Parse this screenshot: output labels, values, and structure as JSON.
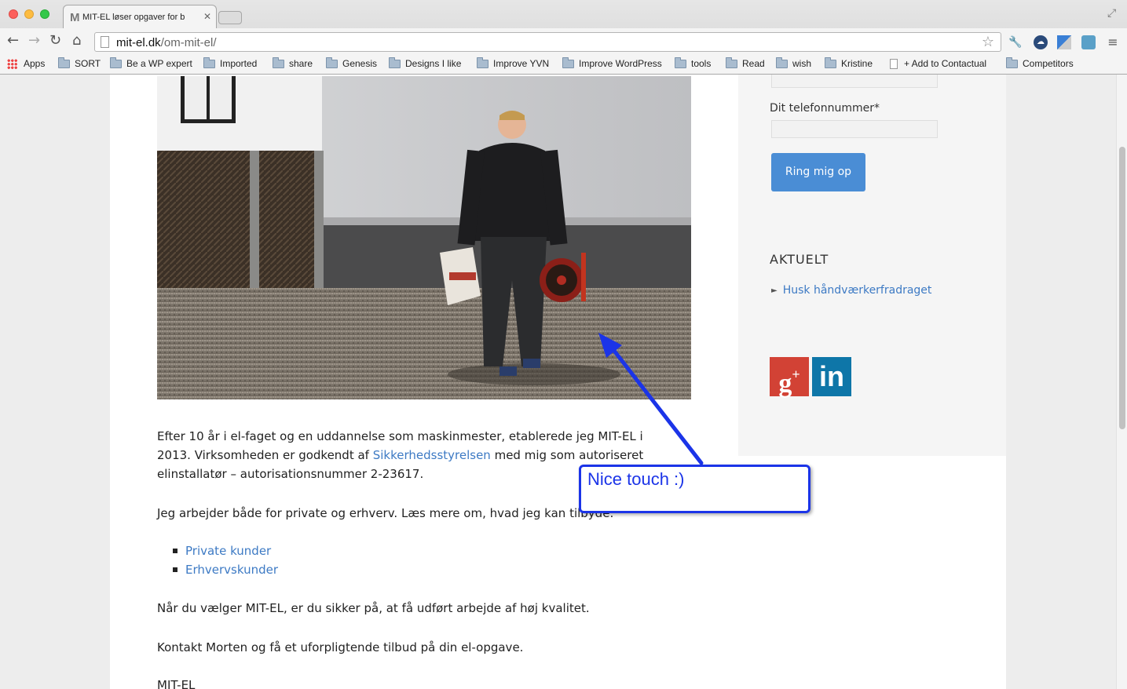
{
  "browser": {
    "tab_title": "MIT-EL løser opgaver for b",
    "tab_icon_letter": "M",
    "url_host": "mit-el.dk",
    "url_path": "/om-mit-el/"
  },
  "bookmarks": [
    {
      "label": "Apps",
      "icon": "apps-grid-icon"
    },
    {
      "label": "SORT",
      "icon": "folder-icon"
    },
    {
      "label": "Be a WP expert",
      "icon": "folder-icon"
    },
    {
      "label": "Imported",
      "icon": "folder-icon"
    },
    {
      "label": "share",
      "icon": "folder-icon"
    },
    {
      "label": "Genesis",
      "icon": "folder-icon"
    },
    {
      "label": "Designs I like",
      "icon": "folder-icon"
    },
    {
      "label": "Improve YVN",
      "icon": "folder-icon"
    },
    {
      "label": "Improve WordPress",
      "icon": "folder-icon"
    },
    {
      "label": "tools",
      "icon": "folder-icon"
    },
    {
      "label": "Read",
      "icon": "folder-icon"
    },
    {
      "label": "wish",
      "icon": "folder-icon"
    },
    {
      "label": "Kristine",
      "icon": "folder-icon"
    },
    {
      "label": "+ Add to Contactual",
      "icon": "page-icon"
    },
    {
      "label": "Competitors",
      "icon": "folder-icon"
    }
  ],
  "main": {
    "para1_before": "Efter 10 år i el-faget og en uddannelse som maskinmester, etablerede jeg MIT-EL i 2013. Virksomheden er godkendt af ",
    "para1_link": "Sikkerhedsstyrelsen",
    "para1_after": " med mig som autoriseret elinstallatør – autorisationsnummer 2-23617.",
    "para2": "Jeg arbejder både for private og erhverv. Læs mere om, hvad jeg kan tilbyde:",
    "links": [
      "Private kunder",
      "Erhvervskunder"
    ],
    "para3": "Når du vælger MIT-EL, er du sikker på, at få udført arbejde af høj kvalitet.",
    "para4": "Kontakt Morten og få et uforpligtende tilbud på din el-opgave.",
    "signature": "MIT-EL"
  },
  "sidebar": {
    "phone_label": "Dit telefonnummer*",
    "phone_value": "",
    "submit_label": "Ring mig op",
    "news_heading": "AKTUELT",
    "news_items": [
      "Husk håndværkerfradraget"
    ],
    "social": [
      {
        "icon": "google-plus-icon",
        "label": "g+"
      },
      {
        "icon": "linkedin-icon",
        "label": "in"
      }
    ]
  },
  "annotation": {
    "text": "Nice touch :)",
    "color": "#1b34e8"
  }
}
